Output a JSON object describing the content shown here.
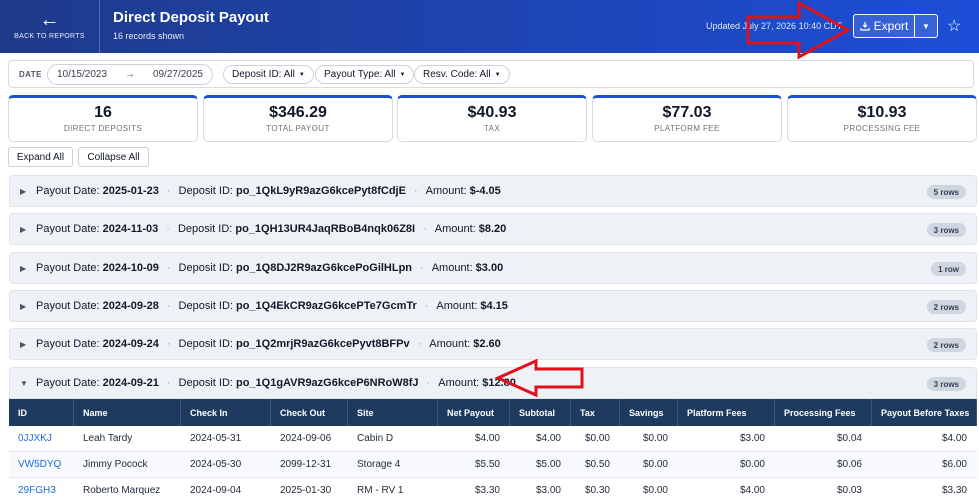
{
  "header": {
    "back_label": "BACK TO REPORTS",
    "title": "Direct Deposit Payout",
    "subtitle": "16 records shown",
    "updated": "Updated July 27, 2026 10:40 CDT",
    "export_label": "Export"
  },
  "filters": {
    "date_label": "DATE",
    "date_start": "10/15/2023",
    "date_end": "09/27/2025",
    "deposit_id": "Deposit ID: All",
    "payout_type": "Payout Type: All",
    "resv_code": "Resv. Code: All"
  },
  "stats": [
    {
      "value": "16",
      "label": "DIRECT DEPOSITS"
    },
    {
      "value": "$346.29",
      "label": "TOTAL PAYOUT"
    },
    {
      "value": "$40.93",
      "label": "TAX"
    },
    {
      "value": "$77.03",
      "label": "PLATFORM FEE"
    },
    {
      "value": "$10.93",
      "label": "PROCESSING FEE"
    }
  ],
  "actions": {
    "expand_all": "Expand All",
    "collapse_all": "Collapse All"
  },
  "group_labels": {
    "payout_date": "Payout Date:",
    "deposit_id": "Deposit ID:",
    "amount": "Amount:"
  },
  "groups": [
    {
      "date": "2025-01-23",
      "deposit_id": "po_1QkL9yR9azG6kcePyt8fCdjE",
      "amount": "$-4.05",
      "rows": "5 rows"
    },
    {
      "date": "2024-11-03",
      "deposit_id": "po_1QH13UR4JaqRBoB4nqk06Z8I",
      "amount": "$8.20",
      "rows": "3 rows"
    },
    {
      "date": "2024-10-09",
      "deposit_id": "po_1Q8DJ2R9azG6kcePoGilHLpn",
      "amount": "$3.00",
      "rows": "1 row"
    },
    {
      "date": "2024-09-28",
      "deposit_id": "po_1Q4EkCR9azG6kcePTe7GcmTr",
      "amount": "$4.15",
      "rows": "2 rows"
    },
    {
      "date": "2024-09-24",
      "deposit_id": "po_1Q2mrjR9azG6kcePyvt8BFPv",
      "amount": "$2.60",
      "rows": "2 rows"
    },
    {
      "date": "2024-09-21",
      "deposit_id": "po_1Q1gAVR9azG6kceP6NRoW8fJ",
      "amount": "$12.80",
      "rows": "3 rows"
    }
  ],
  "table": {
    "columns": [
      "ID",
      "Name",
      "Check In",
      "Check Out",
      "Site",
      "Net Payout",
      "Subtotal",
      "Tax",
      "Savings",
      "Platform Fees",
      "Processing Fees",
      "Payout Before Taxes"
    ],
    "rows": [
      [
        "0JJXKJ",
        "Leah Tardy",
        "2024-05-31",
        "2024-09-06",
        "Cabin D",
        "$4.00",
        "$4.00",
        "$0.00",
        "$0.00",
        "$3.00",
        "$0.04",
        "$4.00"
      ],
      [
        "VW5DYQ",
        "Jimmy Pocock",
        "2024-05-30",
        "2099-12-31",
        "Storage 4",
        "$5.50",
        "$5.00",
        "$0.50",
        "$0.00",
        "$0.00",
        "$0.06",
        "$6.00"
      ],
      [
        "29FGH3",
        "Roberto Marquez",
        "2024-09-04",
        "2025-01-30",
        "RM - RV 1",
        "$3.30",
        "$3.00",
        "$0.30",
        "$0.00",
        "$4.00",
        "$0.03",
        "$3.30"
      ]
    ]
  },
  "colors": {
    "header_start": "#1e3a8a",
    "header_end": "#1d4ed8",
    "accent": "#1d4ed8",
    "table_header": "#1e3a5f",
    "annotation": "#e0101c"
  }
}
